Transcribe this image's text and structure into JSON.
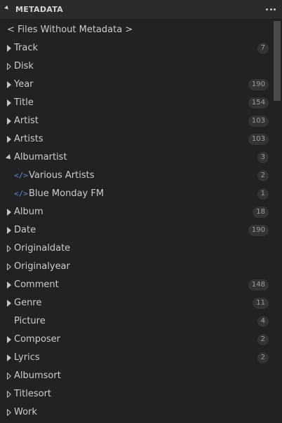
{
  "header": {
    "title": "METADATA",
    "more_icon": "ellipsis-icon"
  },
  "files_without_metadata": "< Files Without Metadata >",
  "items": [
    {
      "label": "Track",
      "count": "7",
      "twisty": "closed"
    },
    {
      "label": "Disk",
      "count": "",
      "twisty": "empty"
    },
    {
      "label": "Year",
      "count": "190",
      "twisty": "closed"
    },
    {
      "label": "Title",
      "count": "154",
      "twisty": "closed"
    },
    {
      "label": "Artist",
      "count": "103",
      "twisty": "closed"
    },
    {
      "label": "Artists",
      "count": "103",
      "twisty": "closed"
    },
    {
      "label": "Albumartist",
      "count": "3",
      "twisty": "open",
      "children": [
        {
          "label": "Various Artists",
          "count": "2",
          "icon": "</>"
        },
        {
          "label": "Blue Monday FM",
          "count": "1",
          "icon": "</>"
        }
      ]
    },
    {
      "label": "Album",
      "count": "18",
      "twisty": "closed"
    },
    {
      "label": "Date",
      "count": "190",
      "twisty": "closed"
    },
    {
      "label": "Originaldate",
      "count": "",
      "twisty": "empty"
    },
    {
      "label": "Originalyear",
      "count": "",
      "twisty": "empty"
    },
    {
      "label": "Comment",
      "count": "148",
      "twisty": "closed"
    },
    {
      "label": "Genre",
      "count": "11",
      "twisty": "closed"
    },
    {
      "label": "Picture",
      "count": "4",
      "twisty": "none"
    },
    {
      "label": "Composer",
      "count": "2",
      "twisty": "closed"
    },
    {
      "label": "Lyrics",
      "count": "2",
      "twisty": "closed"
    },
    {
      "label": "Albumsort",
      "count": "",
      "twisty": "empty"
    },
    {
      "label": "Titlesort",
      "count": "",
      "twisty": "empty"
    },
    {
      "label": "Work",
      "count": "",
      "twisty": "empty"
    }
  ]
}
